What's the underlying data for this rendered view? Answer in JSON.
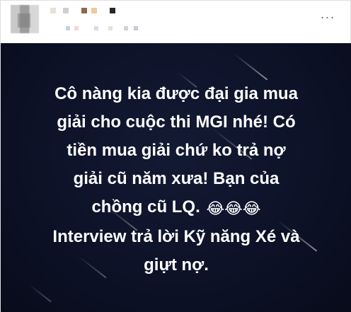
{
  "post": {
    "lines": [
      "Cô nàng kia được đại gia mua",
      "giải cho cuộc thi MGI nhé! Có",
      "tiền mua giải chứ ko trả nợ",
      "giải cũ năm xưa! Bạn của",
      "chồng cũ LQ.",
      "Interview trả lời Kỹ năng Xé và",
      "giựt nợ."
    ],
    "emoji": "😂😂😂"
  },
  "header": {
    "more_label": "···"
  },
  "colors": {
    "background": "#0d1228",
    "text": "#ffffff"
  }
}
